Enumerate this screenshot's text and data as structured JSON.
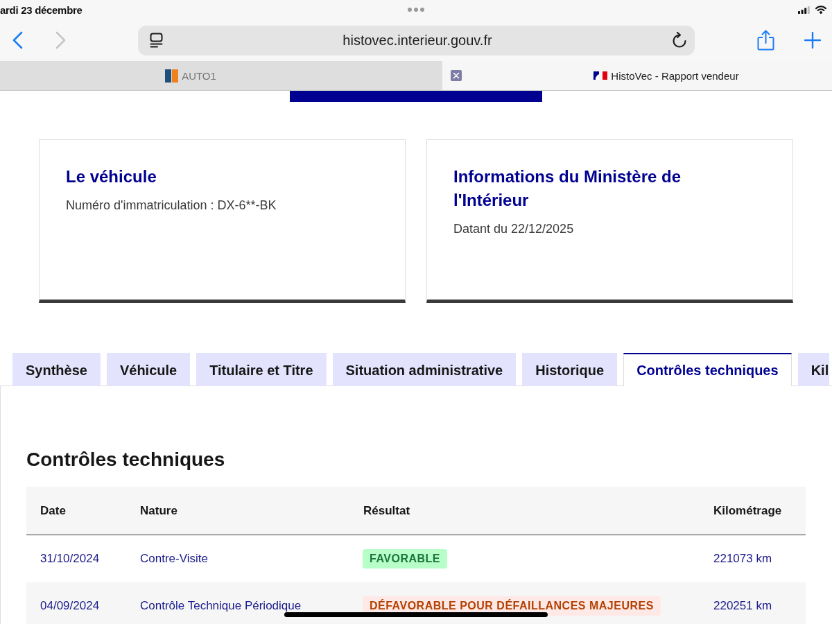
{
  "status_bar": {
    "date": "ardi 23 décembre"
  },
  "browser": {
    "nav": [
      {
        "kind": "back",
        "disabled": false
      },
      {
        "kind": "forward",
        "disabled": true
      }
    ],
    "url": "histovec.interieur.gouv.fr",
    "tabs": [
      {
        "title": "AUTO1",
        "selected": false
      },
      {
        "title": "HistoVec - Rapport vendeur",
        "selected": true
      }
    ]
  },
  "cards": [
    {
      "title": "Le véhicule",
      "text": "Numéro d'immatriculation : DX-6**-BK"
    },
    {
      "title": "Informations du Ministère de l'Intérieur",
      "text": "Datant du 22/12/2025"
    }
  ],
  "tabs": [
    {
      "label": "Synthèse",
      "selected": false
    },
    {
      "label": "Véhicule",
      "selected": false
    },
    {
      "label": "Titulaire et Titre",
      "selected": false
    },
    {
      "label": "Situation administrative",
      "selected": false
    },
    {
      "label": "Historique",
      "selected": false
    },
    {
      "label": "Contrôles techniques",
      "selected": true
    },
    {
      "label": "Kil",
      "selected": false
    }
  ],
  "section": {
    "title": "Contrôles techniques",
    "table": {
      "columns": [
        "Date",
        "Nature",
        "Résultat",
        "Kilométrage"
      ],
      "rows": [
        {
          "date": "31/10/2024",
          "nature": "Contre-Visite",
          "result": {
            "label": "FAVORABLE",
            "kind": "success"
          },
          "mileage": "221073 km"
        },
        {
          "date": "04/09/2024",
          "nature": "Contrôle Technique Périodique",
          "result": {
            "label": "DÉFAVORABLE POUR DÉFAILLANCES MAJEURES",
            "kind": "error"
          },
          "mileage": "220251 km"
        }
      ]
    }
  }
}
